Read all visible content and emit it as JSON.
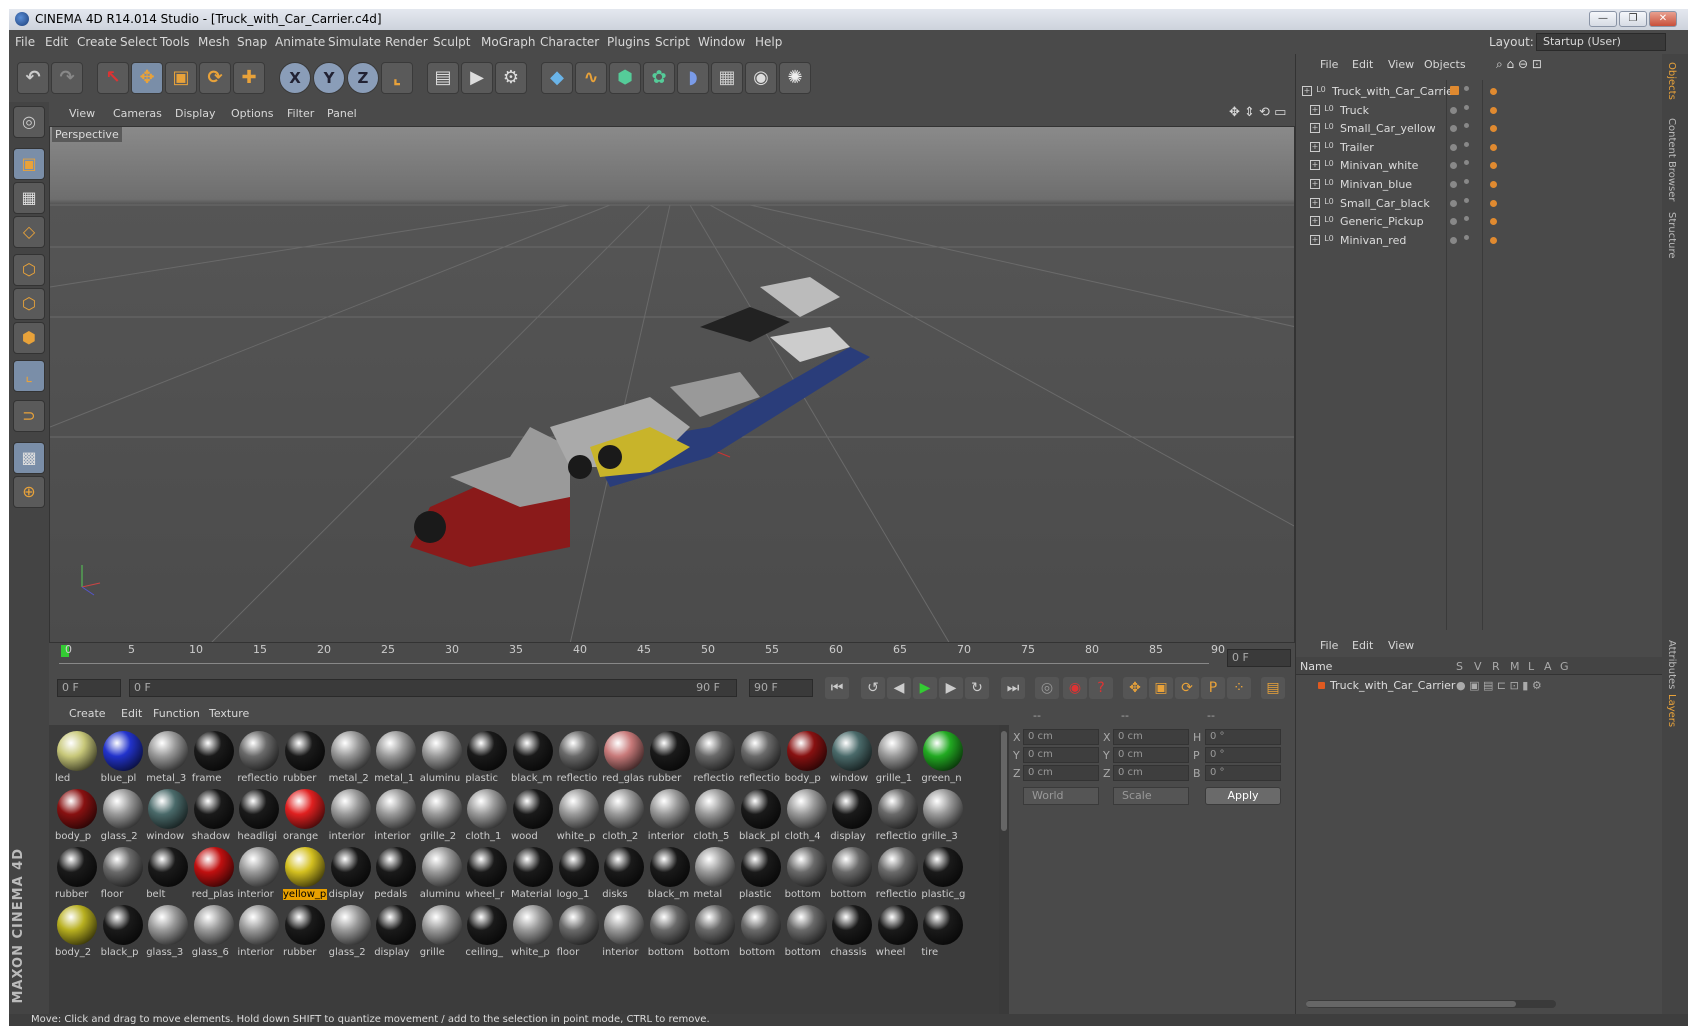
{
  "window": {
    "title": "CINEMA 4D R14.014 Studio - [Truck_with_Car_Carrier.c4d]",
    "minimize": "—",
    "restore": "❐",
    "close": "✕"
  },
  "menu": [
    "File",
    "Edit",
    "Create",
    "Select",
    "Tools",
    "Mesh",
    "Snap",
    "Animate",
    "Simulate",
    "Render",
    "Sculpt",
    "MoGraph",
    "Character",
    "Plugins",
    "Script",
    "Window",
    "Help"
  ],
  "layout": {
    "label": "Layout:",
    "value": "Startup (User)"
  },
  "viewport": {
    "menu": [
      "View",
      "Cameras",
      "Display",
      "Options",
      "Filter",
      "Panel"
    ],
    "label": "Perspective"
  },
  "timeline": {
    "ticks": [
      "0",
      "5",
      "10",
      "15",
      "20",
      "25",
      "30",
      "35",
      "40",
      "45",
      "50",
      "55",
      "60",
      "65",
      "70",
      "75",
      "80",
      "85",
      "90"
    ],
    "frame_field": "0 F"
  },
  "playback": {
    "start": "0 F",
    "range_start": "0 F",
    "range_end": "90 F",
    "end": "90 F"
  },
  "materials": {
    "menu": [
      "Create",
      "Edit",
      "Function",
      "Texture"
    ],
    "items": [
      "led",
      "blue_pl",
      "metal_3",
      "frame",
      "reflectio",
      "rubber",
      "metal_2",
      "metal_1",
      "aluminu",
      "plastic",
      "black_m",
      "reflectio",
      "red_glas",
      "rubber",
      "reflectio",
      "reflectio",
      "body_p",
      "window",
      "grille_1",
      "green_n",
      "body_p",
      "glass_2",
      "window",
      "shadow",
      "headligi",
      "orange",
      "interior",
      "interior",
      "grille_2",
      "cloth_1",
      "wood",
      "white_p",
      "cloth_2",
      "interior",
      "cloth_5",
      "black_pl",
      "cloth_4",
      "display",
      "reflectio",
      "grille_3",
      "rubber",
      "floor",
      "belt",
      "red_plas",
      "interior",
      "yellow_p",
      "display",
      "pedals",
      "aluminu",
      "wheel_r",
      "Material",
      "logo_1",
      "disks",
      "black_m",
      "metal",
      "plastic",
      "bottom",
      "bottom",
      "reflectio",
      "plastic_g",
      "body_2",
      "black_p",
      "glass_3",
      "glass_6",
      "interior",
      "rubber",
      "glass_2",
      "display",
      "grille",
      "ceiling_",
      "white_p",
      "floor",
      "interior",
      "bottom",
      "bottom",
      "bottom",
      "bottom",
      "chassis",
      "wheel",
      "tire"
    ]
  },
  "coords": {
    "headers": [
      "--",
      "--",
      "--"
    ],
    "rows": [
      [
        "X",
        "0 cm",
        "X",
        "0 cm",
        "H",
        "0 °"
      ],
      [
        "Y",
        "0 cm",
        "Y",
        "0 cm",
        "P",
        "0 °"
      ],
      [
        "Z",
        "0 cm",
        "Z",
        "0 cm",
        "B",
        "0 °"
      ]
    ],
    "world": "World",
    "scale": "Scale",
    "apply": "Apply"
  },
  "objects": {
    "menu": [
      "File",
      "Edit",
      "View",
      "Objects"
    ],
    "items": [
      "Truck_with_Car_Carrier",
      "Truck",
      "Small_Car_yellow",
      "Trailer",
      "Minivan_white",
      "Minivan_blue",
      "Small_Car_black",
      "Generic_Pickup",
      "Minivan_red"
    ]
  },
  "layers": {
    "menu": [
      "File",
      "Edit",
      "View"
    ],
    "cols": [
      "Name",
      "S",
      "V",
      "R",
      "M",
      "L",
      "A",
      "G"
    ],
    "item": "Truck_with_Car_Carrier"
  },
  "sidetabs": [
    "Objects",
    "Content Browser",
    "Structure",
    "Attributes",
    "Layers"
  ],
  "brand": "MAXON CINEMA 4D",
  "status": "Move: Click and drag to move elements. Hold down SHIFT to quantize movement / add to the selection in point mode, CTRL to remove."
}
